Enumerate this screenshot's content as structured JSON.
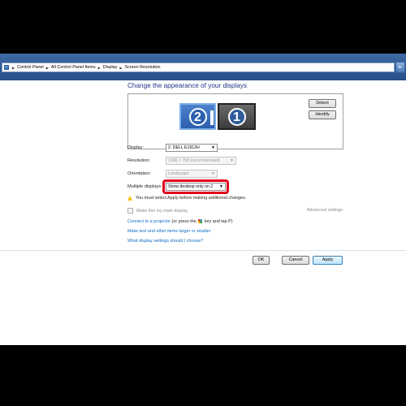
{
  "address_bar": {
    "crumbs": [
      "Control Panel",
      "All Control Panel Items",
      "Display",
      "Screen Resolution"
    ]
  },
  "page": {
    "title": "Change the appearance of your displays"
  },
  "monitors": {
    "primary_number": "1",
    "secondary_number": "2"
  },
  "buttons": {
    "detect": "Detect",
    "identify": "Identify",
    "ok": "OK",
    "cancel": "Cancel",
    "apply": "Apply"
  },
  "settings": {
    "display_label": "Display:",
    "display_value": "2. DELL E1912H",
    "resolution_label": "Resolution:",
    "resolution_value": "1366 × 768 (recommended)",
    "orientation_label": "Orientation:",
    "orientation_value": "Landscape",
    "multiple_label": "Multiple displays:",
    "multiple_value": "Show desktop only on 2"
  },
  "warning": "You must select Apply before making additional changes.",
  "main_display_checkbox": "Make this my main display",
  "advanced_link": "Advanced settings",
  "links": {
    "projector_link": "Connect to a projector",
    "projector_text_before": " (or press the ",
    "projector_text_after": " key and tap P)",
    "text_size": "Make text and other items larger or smaller",
    "which_settings": "What display settings should I choose?"
  },
  "colors": {
    "accent": "#1e3287",
    "link": "#0c6cc2",
    "highlight": "#e4001a",
    "titlebar": "#2c5893"
  },
  "icons": [
    "control-panel-icon",
    "breadcrumb-arrow-icon",
    "dropdown-arrow-icon",
    "warning-icon",
    "windows-key-icon"
  ]
}
